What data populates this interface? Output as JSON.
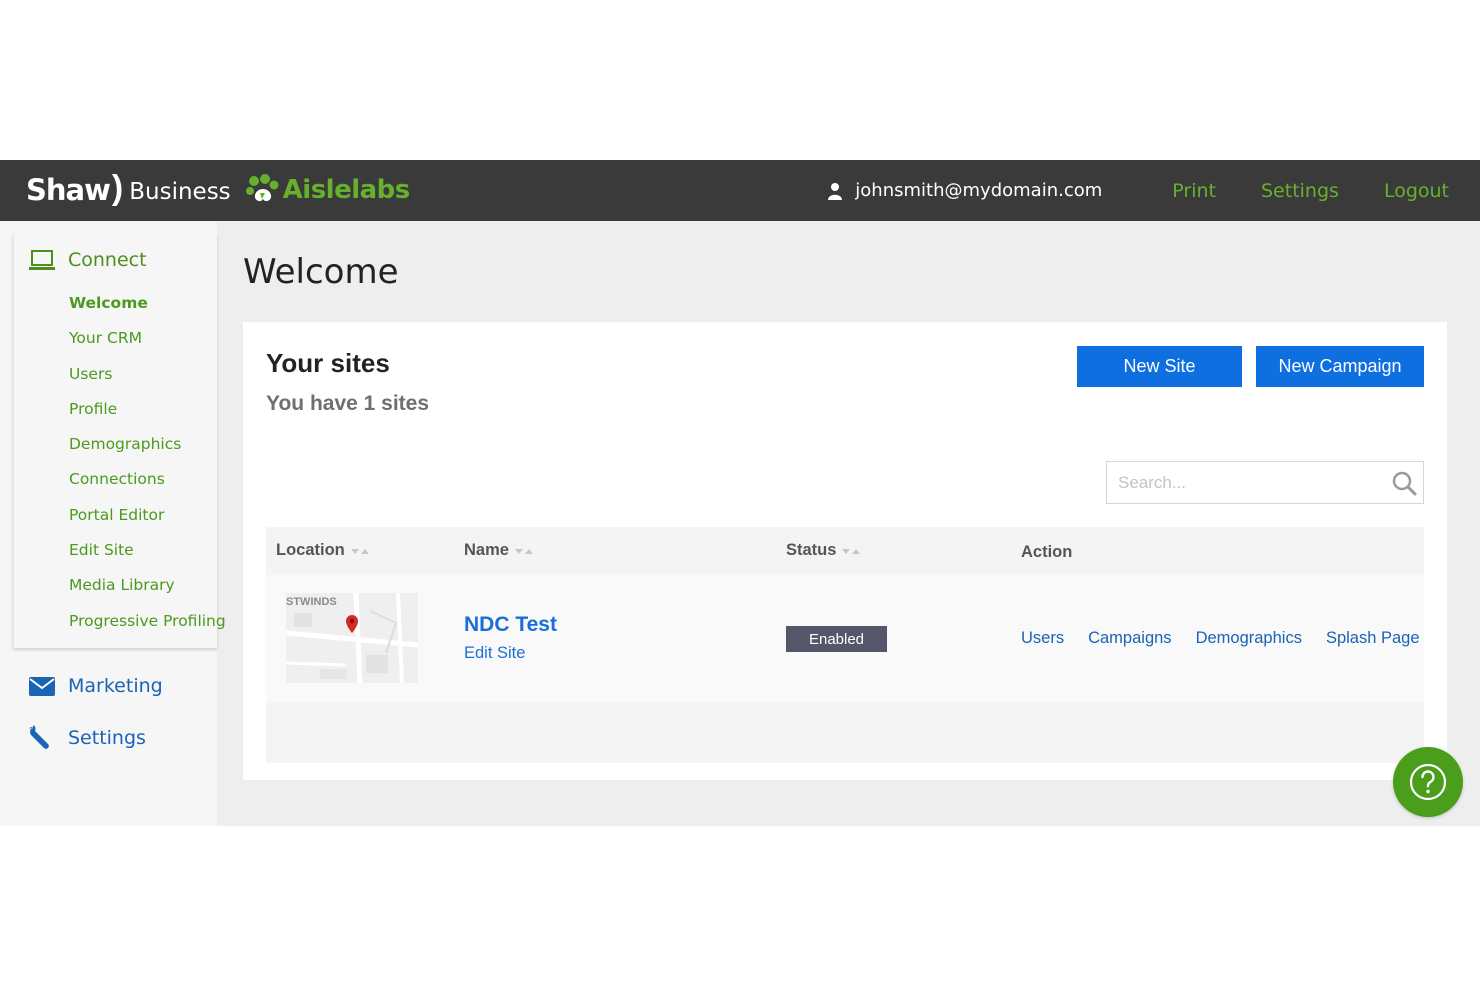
{
  "header": {
    "brand": {
      "shaw": "Shaw",
      "paren": ")",
      "business": "Business",
      "aislelabs": "Aislelabs"
    },
    "user_email": "johnsmith@mydomain.com",
    "links": {
      "print": "Print",
      "settings": "Settings",
      "logout": "Logout"
    }
  },
  "sidebar": {
    "connect": {
      "label": "Connect",
      "icon": "laptop-icon",
      "items": [
        {
          "label": "Welcome",
          "active": true
        },
        {
          "label": "Your CRM"
        },
        {
          "label": "Users"
        },
        {
          "label": "Profile"
        },
        {
          "label": "Demographics"
        },
        {
          "label": "Connections"
        },
        {
          "label": "Portal Editor"
        },
        {
          "label": "Edit Site"
        },
        {
          "label": "Media Library"
        },
        {
          "label": "Progressive Profiling"
        }
      ]
    },
    "marketing": {
      "label": "Marketing",
      "icon": "envelope-icon"
    },
    "settings": {
      "label": "Settings",
      "icon": "wrench-icon"
    }
  },
  "main": {
    "title": "Welcome",
    "sites_title": "Your sites",
    "sites_count_text": "You have 1 sites",
    "buttons": {
      "new_site": "New Site",
      "new_campaign": "New Campaign"
    },
    "search": {
      "placeholder": "Search...",
      "value": ""
    },
    "table": {
      "columns": [
        "Location",
        "Name",
        "Status",
        "Action"
      ],
      "rows": [
        {
          "map_label": "STWINDS",
          "name": "NDC Test",
          "edit_label": "Edit Site",
          "status": "Enabled",
          "actions": [
            "Users",
            "Campaigns",
            "Demographics",
            "Splash Page"
          ]
        }
      ]
    }
  },
  "colors": {
    "header_bg": "#3a3a3a",
    "brand_green": "#66b02e",
    "link_blue": "#1a63b5",
    "button_blue": "#0d6fe0",
    "badge_bg": "#56566a",
    "help_green": "#4a9e1c"
  }
}
